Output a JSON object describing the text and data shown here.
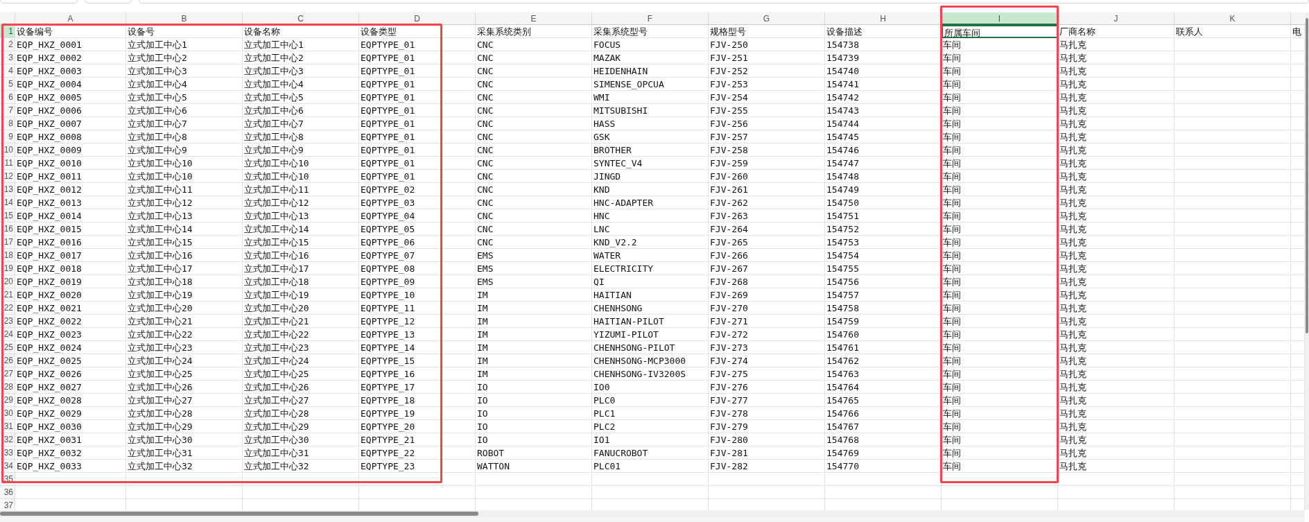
{
  "column_headers": [
    {
      "label": "A",
      "selected": false,
      "highlighted": true
    },
    {
      "label": "B",
      "selected": false,
      "highlighted": true
    },
    {
      "label": "C",
      "selected": false,
      "highlighted": true
    },
    {
      "label": "D",
      "selected": false,
      "highlighted": true
    },
    {
      "label": "E",
      "selected": false,
      "highlighted": false
    },
    {
      "label": "F",
      "selected": false,
      "highlighted": false
    },
    {
      "label": "G",
      "selected": false,
      "highlighted": false
    },
    {
      "label": "H",
      "selected": false,
      "highlighted": false
    },
    {
      "label": "I",
      "selected": true,
      "highlighted": true
    },
    {
      "label": "J",
      "selected": false,
      "highlighted": false
    },
    {
      "label": "K",
      "selected": false,
      "highlighted": false
    }
  ],
  "rows": [
    {
      "number": "1",
      "selected": true,
      "cells": [
        "设备编号",
        "设备号",
        "设备名称",
        "设备类型",
        "采集系统类别",
        "采集系统型号",
        "规格型号",
        "设备描述",
        "所属车间",
        "厂商名称",
        "联系人",
        "电"
      ]
    },
    {
      "number": "2",
      "selected": false,
      "cells": [
        "EQP_HXZ_0001",
        "立式加工中心1",
        "立式加工中心1",
        "EQPTYPE_01",
        "CNC",
        "FOCUS",
        "FJV-250",
        "154738",
        "车间",
        "马扎克"
      ]
    },
    {
      "number": "3",
      "selected": false,
      "cells": [
        "EQP_HXZ_0002",
        "立式加工中心2",
        "立式加工中心2",
        "EQPTYPE_01",
        "CNC",
        "MAZAK",
        "FJV-251",
        "154739",
        "车间",
        "马扎克"
      ]
    },
    {
      "number": "4",
      "selected": false,
      "cells": [
        "EQP_HXZ_0003",
        "立式加工中心3",
        "立式加工中心3",
        "EQPTYPE_01",
        "CNC",
        "HEIDENHAIN",
        "FJV-252",
        "154740",
        "车间",
        "马扎克"
      ]
    },
    {
      "number": "5",
      "selected": false,
      "cells": [
        "EQP_HXZ_0004",
        "立式加工中心4",
        "立式加工中心4",
        "EQPTYPE_01",
        "CNC",
        "SIMENSE_OPCUA",
        "FJV-253",
        "154741",
        "车间",
        "马扎克"
      ]
    },
    {
      "number": "6",
      "selected": false,
      "cells": [
        "EQP_HXZ_0005",
        "立式加工中心5",
        "立式加工中心5",
        "EQPTYPE_01",
        "CNC",
        "WMI",
        "FJV-254",
        "154742",
        "车间",
        "马扎克"
      ]
    },
    {
      "number": "7",
      "selected": false,
      "cells": [
        "EQP_HXZ_0006",
        "立式加工中心6",
        "立式加工中心6",
        "EQPTYPE_01",
        "CNC",
        "MITSUBISHI",
        "FJV-255",
        "154743",
        "车间",
        "马扎克"
      ]
    },
    {
      "number": "8",
      "selected": false,
      "cells": [
        "EQP_HXZ_0007",
        "立式加工中心7",
        "立式加工中心7",
        "EQPTYPE_01",
        "CNC",
        "HASS",
        "FJV-256",
        "154744",
        "车间",
        "马扎克"
      ]
    },
    {
      "number": "9",
      "selected": false,
      "cells": [
        "EQP_HXZ_0008",
        "立式加工中心8",
        "立式加工中心8",
        "EQPTYPE_01",
        "CNC",
        "GSK",
        "FJV-257",
        "154745",
        "车间",
        "马扎克"
      ]
    },
    {
      "number": "10",
      "selected": false,
      "cells": [
        "EQP_HXZ_0009",
        "立式加工中心9",
        "立式加工中心9",
        "EQPTYPE_01",
        "CNC",
        "BROTHER",
        "FJV-258",
        "154746",
        "车间",
        "马扎克"
      ]
    },
    {
      "number": "11",
      "selected": false,
      "cells": [
        "EQP_HXZ_0010",
        "立式加工中心10",
        "立式加工中心10",
        "EQPTYPE_01",
        "CNC",
        "SYNTEC_V4",
        "FJV-259",
        "154747",
        "车间",
        "马扎克"
      ]
    },
    {
      "number": "12",
      "selected": false,
      "cells": [
        "EQP_HXZ_0011",
        "立式加工中心10",
        "立式加工中心10",
        "EQPTYPE_01",
        "CNC",
        "JINGD",
        "FJV-260",
        "154748",
        "车间",
        "马扎克"
      ]
    },
    {
      "number": "13",
      "selected": false,
      "cells": [
        "EQP_HXZ_0012",
        "立式加工中心11",
        "立式加工中心11",
        "EQPTYPE_02",
        "CNC",
        "KND",
        "FJV-261",
        "154749",
        "车间",
        "马扎克"
      ]
    },
    {
      "number": "14",
      "selected": false,
      "cells": [
        "EQP_HXZ_0013",
        "立式加工中心12",
        "立式加工中心12",
        "EQPTYPE_03",
        "CNC",
        "HNC-ADAPTER",
        "FJV-262",
        "154750",
        "车间",
        "马扎克"
      ]
    },
    {
      "number": "15",
      "selected": false,
      "cells": [
        "EQP_HXZ_0014",
        "立式加工中心13",
        "立式加工中心13",
        "EQPTYPE_04",
        "CNC",
        "HNC",
        "FJV-263",
        "154751",
        "车间",
        "马扎克"
      ]
    },
    {
      "number": "16",
      "selected": false,
      "cells": [
        "EQP_HXZ_0015",
        "立式加工中心14",
        "立式加工中心14",
        "EQPTYPE_05",
        "CNC",
        "LNC",
        "FJV-264",
        "154752",
        "车间",
        "马扎克"
      ]
    },
    {
      "number": "17",
      "selected": false,
      "cells": [
        "EQP_HXZ_0016",
        "立式加工中心15",
        "立式加工中心15",
        "EQPTYPE_06",
        "CNC",
        "KND_V2.2",
        "FJV-265",
        "154753",
        "车间",
        "马扎克"
      ]
    },
    {
      "number": "18",
      "selected": false,
      "cells": [
        "EQP_HXZ_0017",
        "立式加工中心16",
        "立式加工中心16",
        "EQPTYPE_07",
        "EMS",
        "WATER",
        "FJV-266",
        "154754",
        "车间",
        "马扎克"
      ]
    },
    {
      "number": "19",
      "selected": false,
      "cells": [
        "EQP_HXZ_0018",
        "立式加工中心17",
        "立式加工中心17",
        "EQPTYPE_08",
        "EMS",
        "ELECTRICITY",
        "FJV-267",
        "154755",
        "车间",
        "马扎克"
      ]
    },
    {
      "number": "20",
      "selected": false,
      "cells": [
        "EQP_HXZ_0019",
        "立式加工中心18",
        "立式加工中心18",
        "EQPTYPE_09",
        "EMS",
        "QI",
        "FJV-268",
        "154756",
        "车间",
        "马扎克"
      ]
    },
    {
      "number": "21",
      "selected": false,
      "cells": [
        "EQP_HXZ_0020",
        "立式加工中心19",
        "立式加工中心19",
        "EQPTYPE_10",
        "IM",
        "HAITIAN",
        "FJV-269",
        "154757",
        "车间",
        "马扎克"
      ]
    },
    {
      "number": "22",
      "selected": false,
      "cells": [
        "EQP_HXZ_0021",
        "立式加工中心20",
        "立式加工中心20",
        "EQPTYPE_11",
        "IM",
        "CHENHSONG",
        "FJV-270",
        "154758",
        "车间",
        "马扎克"
      ]
    },
    {
      "number": "23",
      "selected": false,
      "cells": [
        "EQP_HXZ_0022",
        "立式加工中心21",
        "立式加工中心21",
        "EQPTYPE_12",
        "IM",
        "HAITIAN-PILOT",
        "FJV-271",
        "154759",
        "车间",
        "马扎克"
      ]
    },
    {
      "number": "24",
      "selected": false,
      "cells": [
        "EQP_HXZ_0023",
        "立式加工中心22",
        "立式加工中心22",
        "EQPTYPE_13",
        "IM",
        "YIZUMI-PILOT",
        "FJV-272",
        "154760",
        "车间",
        "马扎克"
      ]
    },
    {
      "number": "25",
      "selected": false,
      "cells": [
        "EQP_HXZ_0024",
        "立式加工中心23",
        "立式加工中心23",
        "EQPTYPE_14",
        "IM",
        "CHENHSONG-PILOT",
        "FJV-273",
        "154761",
        "车间",
        "马扎克"
      ]
    },
    {
      "number": "26",
      "selected": false,
      "cells": [
        "EQP_HXZ_0025",
        "立式加工中心24",
        "立式加工中心24",
        "EQPTYPE_15",
        "IM",
        "CHENHSONG-MCP3000",
        "FJV-274",
        "154762",
        "车间",
        "马扎克"
      ]
    },
    {
      "number": "27",
      "selected": false,
      "cells": [
        "EQP_HXZ_0026",
        "立式加工中心25",
        "立式加工中心25",
        "EQPTYPE_16",
        "IM",
        "CHENHSONG-IV3200S",
        "FJV-275",
        "154763",
        "车间",
        "马扎克"
      ]
    },
    {
      "number": "28",
      "selected": false,
      "cells": [
        "EQP_HXZ_0027",
        "立式加工中心26",
        "立式加工中心26",
        "EQPTYPE_17",
        "IO",
        "IO0",
        "FJV-276",
        "154764",
        "车间",
        "马扎克"
      ]
    },
    {
      "number": "29",
      "selected": false,
      "cells": [
        "EQP_HXZ_0028",
        "立式加工中心27",
        "立式加工中心27",
        "EQPTYPE_18",
        "IO",
        "PLC0",
        "FJV-277",
        "154765",
        "车间",
        "马扎克"
      ]
    },
    {
      "number": "30",
      "selected": false,
      "cells": [
        "EQP_HXZ_0029",
        "立式加工中心28",
        "立式加工中心28",
        "EQPTYPE_19",
        "IO",
        "PLC1",
        "FJV-278",
        "154766",
        "车间",
        "马扎克"
      ]
    },
    {
      "number": "31",
      "selected": false,
      "cells": [
        "EQP_HXZ_0030",
        "立式加工中心29",
        "立式加工中心29",
        "EQPTYPE_20",
        "IO",
        "PLC2",
        "FJV-279",
        "154767",
        "车间",
        "马扎克"
      ]
    },
    {
      "number": "32",
      "selected": false,
      "cells": [
        "EQP_HXZ_0031",
        "立式加工中心30",
        "立式加工中心30",
        "EQPTYPE_21",
        "IO",
        "IO1",
        "FJV-280",
        "154768",
        "车间",
        "马扎克"
      ]
    },
    {
      "number": "33",
      "selected": false,
      "cells": [
        "EQP_HXZ_0032",
        "立式加工中心31",
        "立式加工中心31",
        "EQPTYPE_22",
        "ROBOT",
        "FANUCROBOT",
        "FJV-281",
        "154769",
        "车间",
        "马扎克"
      ]
    },
    {
      "number": "34",
      "selected": false,
      "cells": [
        "EQP_HXZ_0033",
        "立式加工中心32",
        "立式加工中心32",
        "EQPTYPE_23",
        "WATTON",
        "PLC01",
        "FJV-282",
        "154770",
        "车间",
        "马扎克"
      ]
    },
    {
      "number": "35",
      "selected": false
    },
    {
      "number": "36",
      "selected": false
    },
    {
      "number": "37",
      "selected": false
    }
  ]
}
